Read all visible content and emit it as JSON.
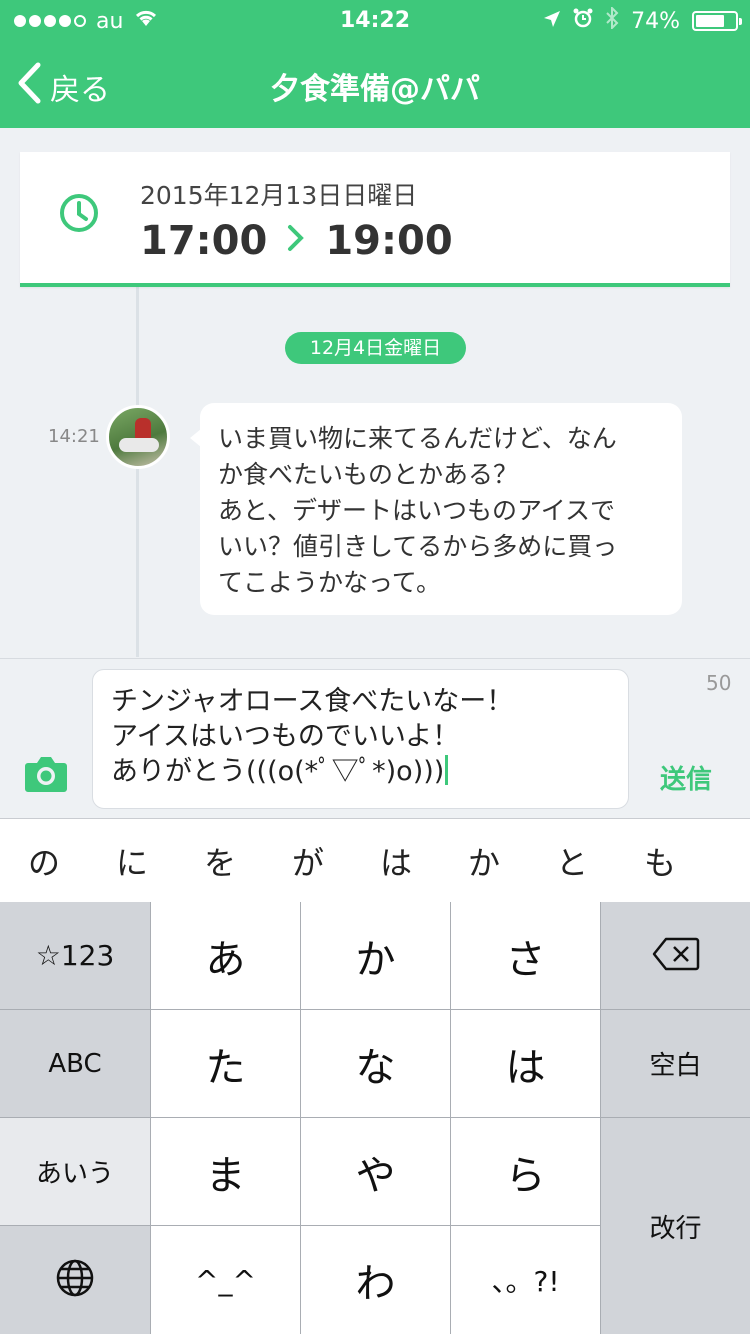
{
  "status_bar": {
    "carrier": "au",
    "time": "14:22",
    "battery": "74%",
    "battery_level": 0.74
  },
  "nav": {
    "back_label": "戻る",
    "title": "夕食準備@パパ"
  },
  "schedule": {
    "date": "2015年12月13日日曜日",
    "start": "17:00",
    "end": "19:00"
  },
  "chat": {
    "date_divider": "12月4日金曜日",
    "messages": [
      {
        "time": "14:21",
        "text": "いま買い物に来てるんだけど、なん\nか食べたいものとかある？\nあと、デザートはいつものアイスで\nいい？値引きしてるから多めに買っ\nてこようかなって。"
      }
    ]
  },
  "composer": {
    "text": "チンジャオロース食べたいなー！\nアイスはいつものでいいよ！\nありがとう(((o(*ﾟ▽ﾟ*)o)))",
    "char_count": "50",
    "send_label": "送信"
  },
  "suggestions": [
    "の",
    "に",
    "を",
    "が",
    "は",
    "か",
    "と",
    "も"
  ],
  "keyboard": {
    "symbols": "☆123",
    "abc": "ABC",
    "aiu": "あいう",
    "a": "あ",
    "ka": "か",
    "sa": "さ",
    "ta": "た",
    "na": "な",
    "ha": "は",
    "ma": "ま",
    "ya": "や",
    "ra": "ら",
    "kaomoji": "^_^",
    "wa": "わ",
    "punct": "、。?!",
    "space": "空白",
    "return": "改行"
  },
  "colors": {
    "accent": "#3ec87b",
    "background": "#eef1f4"
  }
}
